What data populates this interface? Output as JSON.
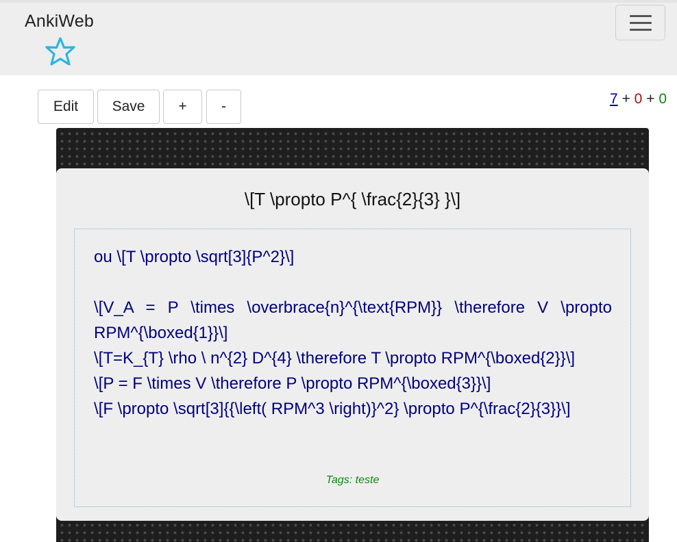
{
  "navbar": {
    "brand": "AnkiWeb",
    "logo_icon": "star-outline-icon",
    "menu_icon": "hamburger-menu-icon"
  },
  "toolbar": {
    "edit_label": "Edit",
    "save_label": "Save",
    "plus_label": "+",
    "minus_label": "-"
  },
  "counts": {
    "new": "7",
    "learn": "0",
    "review": "0",
    "separator": "+",
    "colors": {
      "new": "#000088",
      "learn": "#aa1111",
      "review": "#118811"
    }
  },
  "card": {
    "question": "\\[T \\propto P^{ \\frac{2}{3} }\\]",
    "answer_lines": [
      "ou \\[T \\propto \\sqrt[3]{P^2}\\]",
      "",
      "\\[V_A = P \\times \\overbrace{n}^{\\text{RPM}} \\therefore V \\propto RPM^{\\boxed{1}}\\]",
      "\\[T=K_{T} \\rho \\ n^{2} D^{4} \\therefore T \\propto RPM^{\\boxed{2}}\\]",
      "\\[P = F \\times V \\therefore P \\propto RPM^{\\boxed{3}}\\]",
      "\\[F \\propto \\sqrt[3]{{\\left( RPM^3 \\right)}^2} \\propto P^{\\frac{2}{3}}\\]"
    ],
    "tags": "Tags: teste",
    "colors": {
      "answer_text": "#000080",
      "tags": "#118811"
    }
  }
}
